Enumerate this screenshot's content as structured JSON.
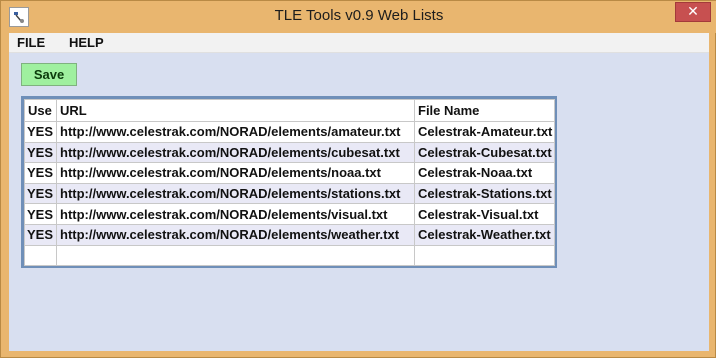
{
  "window": {
    "title": "TLE Tools v0.9  Web Lists",
    "close_glyph": "✕"
  },
  "menu": {
    "file": "FILE",
    "help": "HELP"
  },
  "toolbar": {
    "save_label": "Save"
  },
  "table": {
    "headers": [
      "Use",
      "URL",
      "File Name"
    ],
    "rows": [
      {
        "use": "YES",
        "url": "http://www.celestrak.com/NORAD/elements/amateur.txt",
        "file": "Celestrak-Amateur.txt"
      },
      {
        "use": "YES",
        "url": "http://www.celestrak.com/NORAD/elements/cubesat.txt",
        "file": "Celestrak-Cubesat.txt"
      },
      {
        "use": "YES",
        "url": "http://www.celestrak.com/NORAD/elements/noaa.txt",
        "file": "Celestrak-Noaa.txt"
      },
      {
        "use": "YES",
        "url": "http://www.celestrak.com/NORAD/elements/stations.txt",
        "file": "Celestrak-Stations.txt"
      },
      {
        "use": "YES",
        "url": "http://www.celestrak.com/NORAD/elements/visual.txt",
        "file": "Celestrak-Visual.txt"
      },
      {
        "use": "YES",
        "url": "http://www.celestrak.com/NORAD/elements/weather.txt",
        "file": "Celestrak-Weather.txt"
      },
      {
        "use": "",
        "url": "",
        "file": ""
      }
    ]
  },
  "colors": {
    "title_bar": "#e9b66f",
    "client_bg": "#d8dff0",
    "save_button": "#9ff09f",
    "close_button": "#c75050",
    "table_border": "#6f8fb8"
  },
  "icons": {
    "app": "satellite-icon",
    "close": "close-icon"
  }
}
